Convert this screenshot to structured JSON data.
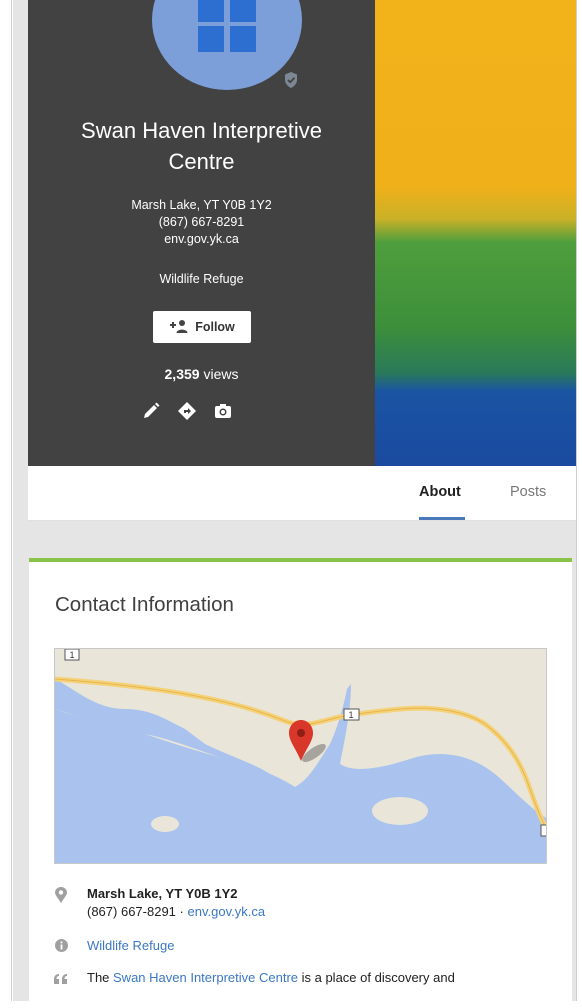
{
  "profile": {
    "name_line1": "Swan Haven Interpretive",
    "name_line2": "Centre",
    "address": "Marsh Lake, YT Y0B 1Y2",
    "phone": "(867) 667-8291",
    "website": "env.gov.yk.ca",
    "category": "Wildlife Refuge",
    "follow_label": "Follow",
    "views_count": "2,359",
    "views_label": "views"
  },
  "icons": {
    "verified": "verified-badge-icon",
    "follow": "add-person-icon",
    "edit": "pencil-icon",
    "directions": "directions-icon",
    "photo": "camera-icon",
    "location": "map-pin-icon",
    "info": "info-icon",
    "quote": "quote-icon"
  },
  "tabs": [
    {
      "label": "About",
      "active": true
    },
    {
      "label": "Posts",
      "active": false
    }
  ],
  "contact": {
    "title": "Contact Information",
    "map_route_number": "1",
    "address": "Marsh Lake, YT Y0B 1Y2",
    "phone": "(867) 667-8291",
    "separator": "·",
    "website": "env.gov.yk.ca",
    "category": "Wildlife Refuge",
    "description_prefix": "The ",
    "description_link": "Swan Haven Interpretive Centre",
    "description_suffix": " is a place of discovery and"
  },
  "colors": {
    "hero_bg": "#424242",
    "accent_green": "#8bc34a",
    "link_blue": "#3b78c4",
    "tab_underline": "#4a79b9",
    "map_pin": "#d8372a"
  }
}
